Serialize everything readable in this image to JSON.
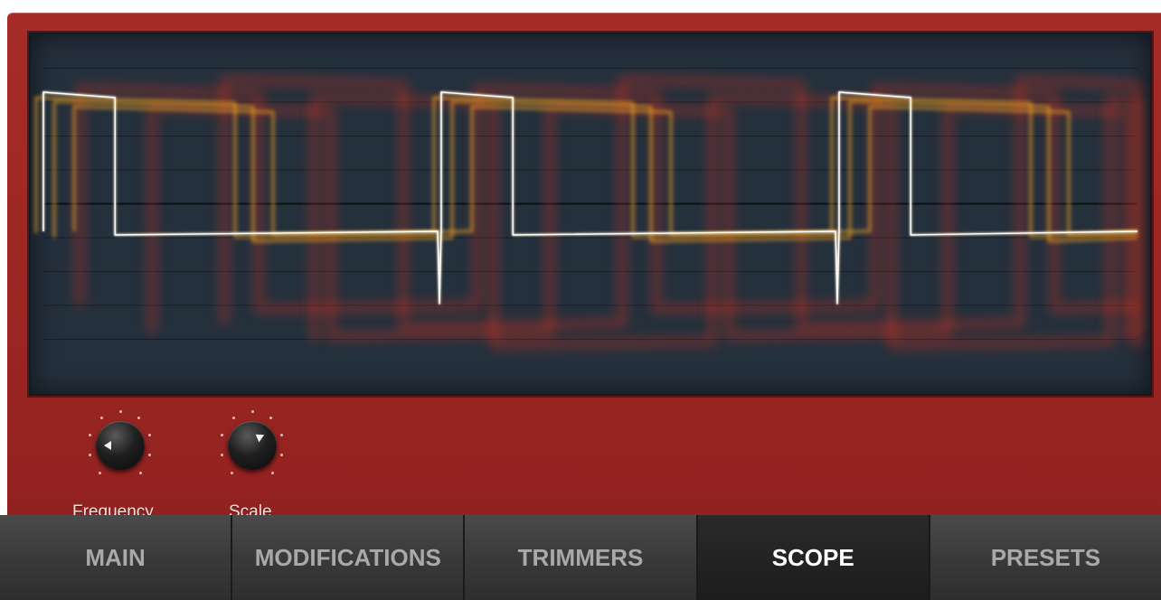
{
  "knobs": [
    {
      "label": "Frequency"
    },
    {
      "label": "Scale"
    }
  ],
  "tabs": [
    {
      "label": "MAIN",
      "active": false
    },
    {
      "label": "MODIFICATIONS",
      "active": false
    },
    {
      "label": "TRIMMERS",
      "active": false
    },
    {
      "label": "SCOPE",
      "active": true
    },
    {
      "label": "PRESETS",
      "active": false
    }
  ],
  "colors": {
    "panel": "#9e2724",
    "scope_bg": "#25303d",
    "trace_main": "#fff4d6",
    "trace_orange": "#f5a623",
    "trace_red": "#e0321e",
    "tab_active_text": "#ffffff",
    "tab_text": "#a9a9a9"
  }
}
